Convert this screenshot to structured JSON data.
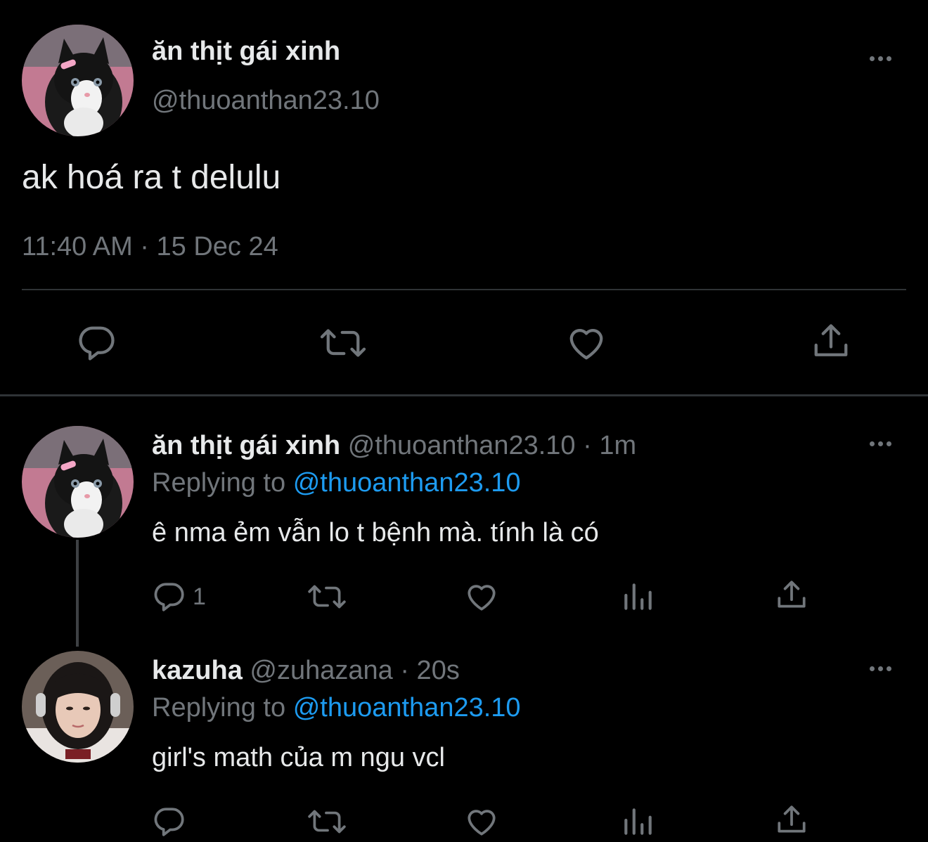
{
  "main_tweet": {
    "display_name": "ăn thịt gái xinh",
    "handle": "@thuoanthan23.10",
    "text": "ak hoá ra t delulu",
    "timestamp": "11:40 AM · 15 Dec 24",
    "actions": [
      "reply-icon",
      "retweet-icon",
      "like-icon",
      "share-icon"
    ]
  },
  "replies": [
    {
      "display_name": "ăn thịt gái xinh",
      "handle": "@thuoanthan23.10",
      "time": "· 1m",
      "replying_prefix": "Replying to",
      "replying_to": "@thuoanthan23.10",
      "text": "ê nma ẻm vẫn lo t bệnh mà. tính là có",
      "reply_count": "1"
    },
    {
      "display_name": "kazuha",
      "handle": "@zuhazana",
      "time": "· 20s",
      "replying_prefix": "Replying to",
      "replying_to": "@thuoanthan23.10",
      "text": "girl's math của m ngu vcl",
      "reply_count": ""
    }
  ],
  "colors": {
    "background": "#000000",
    "text": "#e7e9ea",
    "muted": "#71767b",
    "link": "#1d9bf0",
    "divider": "#2f3336"
  }
}
